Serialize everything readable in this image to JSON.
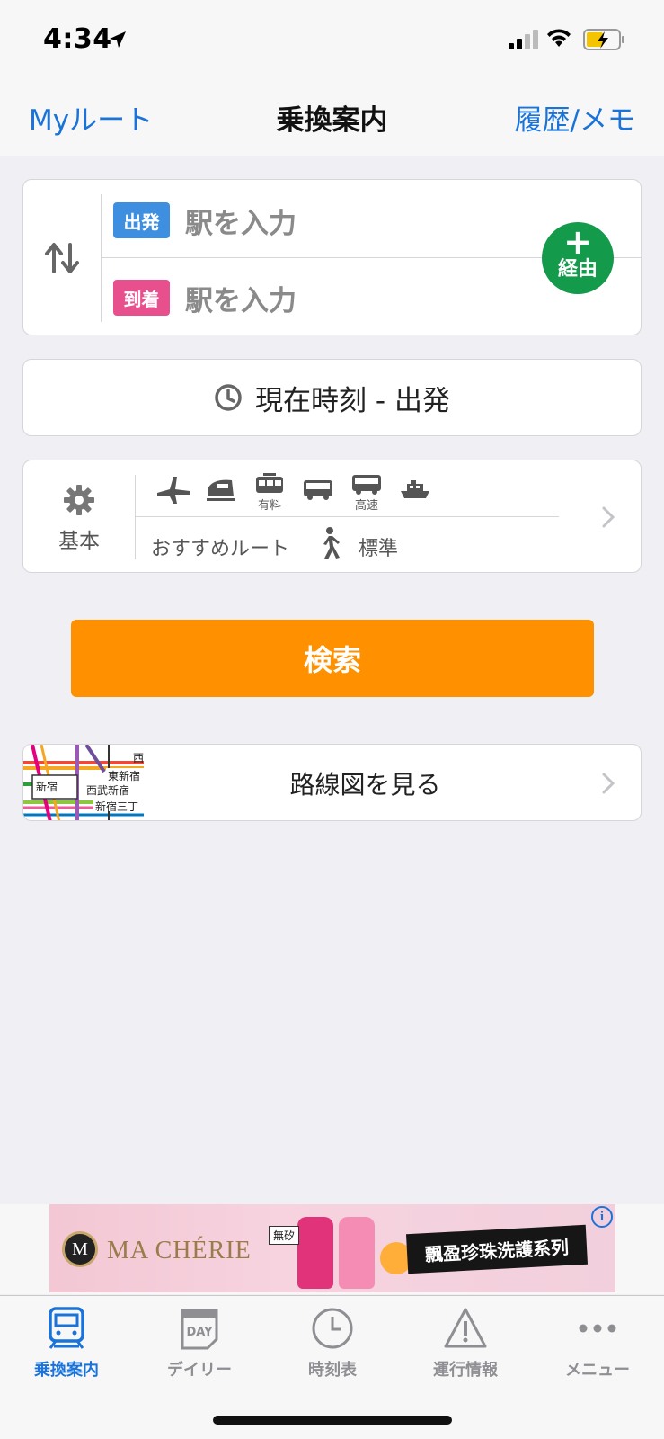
{
  "status_bar": {
    "time": "4:34"
  },
  "nav": {
    "left": "Myルート",
    "title": "乗換案内",
    "right": "履歴/メモ"
  },
  "stations": {
    "departure_tag": "出発",
    "departure_placeholder": "駅を入力",
    "arrival_tag": "到着",
    "arrival_placeholder": "駅を入力",
    "via_plus": "+",
    "via_label": "経由"
  },
  "time_setting": {
    "label": "現在時刻 - 出発"
  },
  "conditions": {
    "gear_label": "基本",
    "transport_icons": [
      {
        "icon": "airplane-icon",
        "sub": ""
      },
      {
        "icon": "shinkansen-icon",
        "sub": ""
      },
      {
        "icon": "paid-train-icon",
        "sub": "有料"
      },
      {
        "icon": "bus-icon",
        "sub": ""
      },
      {
        "icon": "highway-bus-icon",
        "sub": "高速"
      },
      {
        "icon": "ferry-icon",
        "sub": ""
      }
    ],
    "route_pref": "おすすめルート",
    "walk_speed": "標準"
  },
  "search_button": "検索",
  "route_map": {
    "label": "路線図を見る",
    "thumb_labels": {
      "shinjuku": "新宿",
      "seibu_shinjuku": "西武新宿",
      "higashi_shinjuku": "東新宿",
      "shinjuku_sanchome": "新宿三丁",
      "nishi": "西"
    }
  },
  "ad": {
    "logo_letter": "M",
    "brand": "MA CHÉRIE",
    "tag": "無矽",
    "slogan": "飄盈珍珠洗護系列",
    "info": "i"
  },
  "tabs": [
    {
      "label": "乗換案内",
      "icon": "train-icon",
      "active": true
    },
    {
      "label": "デイリー",
      "icon": "daily-calendar-icon",
      "active": false
    },
    {
      "label": "時刻表",
      "icon": "clock-icon",
      "active": false
    },
    {
      "label": "運行情報",
      "icon": "warning-icon",
      "active": false
    },
    {
      "label": "メニュー",
      "icon": "more-icon",
      "active": false
    }
  ],
  "colors": {
    "accent_blue": "#1a73d9",
    "departure": "#3f8fe0",
    "arrival": "#e8508d",
    "via_green": "#139a4a",
    "search_orange": "#ff9100"
  }
}
